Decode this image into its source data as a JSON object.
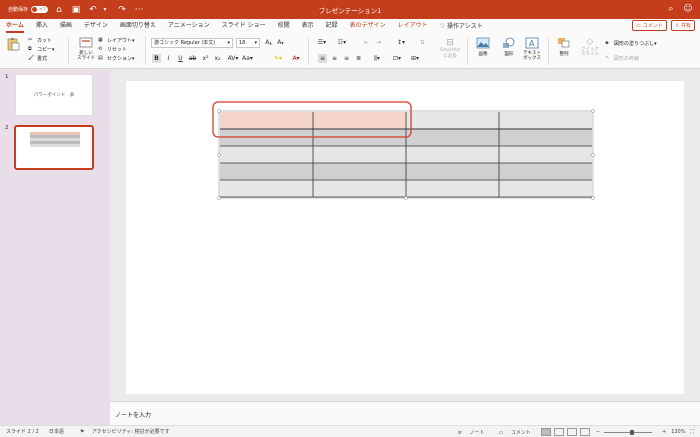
{
  "titlebar": {
    "autosave_label": "自動保存",
    "autosave_state": "オフ",
    "title": "プレゼンテーション1"
  },
  "tabs": [
    {
      "label": "ホーム",
      "active": true
    },
    {
      "label": "挿入"
    },
    {
      "label": "描画"
    },
    {
      "label": "デザイン"
    },
    {
      "label": "画面切り替え"
    },
    {
      "label": "アニメーション"
    },
    {
      "label": "スライド ショー"
    },
    {
      "label": "校閲"
    },
    {
      "label": "表示"
    },
    {
      "label": "記録"
    },
    {
      "label": "表のデザイン",
      "accent": true
    },
    {
      "label": "レイアウト",
      "accent": true
    },
    {
      "label": "操作アシスト"
    }
  ],
  "tab_buttons": {
    "comment": "コメント",
    "share": "共有"
  },
  "ribbon": {
    "cut": "カット",
    "copy": "コピー",
    "format": "書式",
    "new_slide_1": "新しい",
    "new_slide_2": "スライド",
    "layout": "レイアウト",
    "reset": "リセット",
    "section": "セクション",
    "font_name": "游ゴシック Regular (本文)",
    "font_size": "18",
    "smartart_1": "SmartArt",
    "smartart_2": "に変換",
    "picture": "画像",
    "shape": "図形",
    "textbox_1": "テキスト",
    "textbox_2": "ボックス",
    "arrange": "整列",
    "quick_style_1": "クイック",
    "quick_style_2": "スタイル",
    "shape_fill": "図形の塗りつぶし",
    "shape_outline": "図形の枠線"
  },
  "slides": [
    {
      "number": "1",
      "text": "パワーポイント　表"
    },
    {
      "number": "2",
      "text": ""
    }
  ],
  "table": {
    "rows": 5,
    "cols": 4
  },
  "notes_placeholder": "ノートを入力",
  "status": {
    "slide": "スライド 2 / 2",
    "language": "日本語",
    "accessibility": "アクセシビリティ: 検討が必要です",
    "notes": "ノート",
    "comments": "コメント",
    "zoom": "120%"
  },
  "colors": {
    "accent": "#c43e1c",
    "highlight_cell": "#f4d4cb",
    "table_gray_dark": "#d0d0d0",
    "table_gray_light": "#e6e6e6"
  }
}
